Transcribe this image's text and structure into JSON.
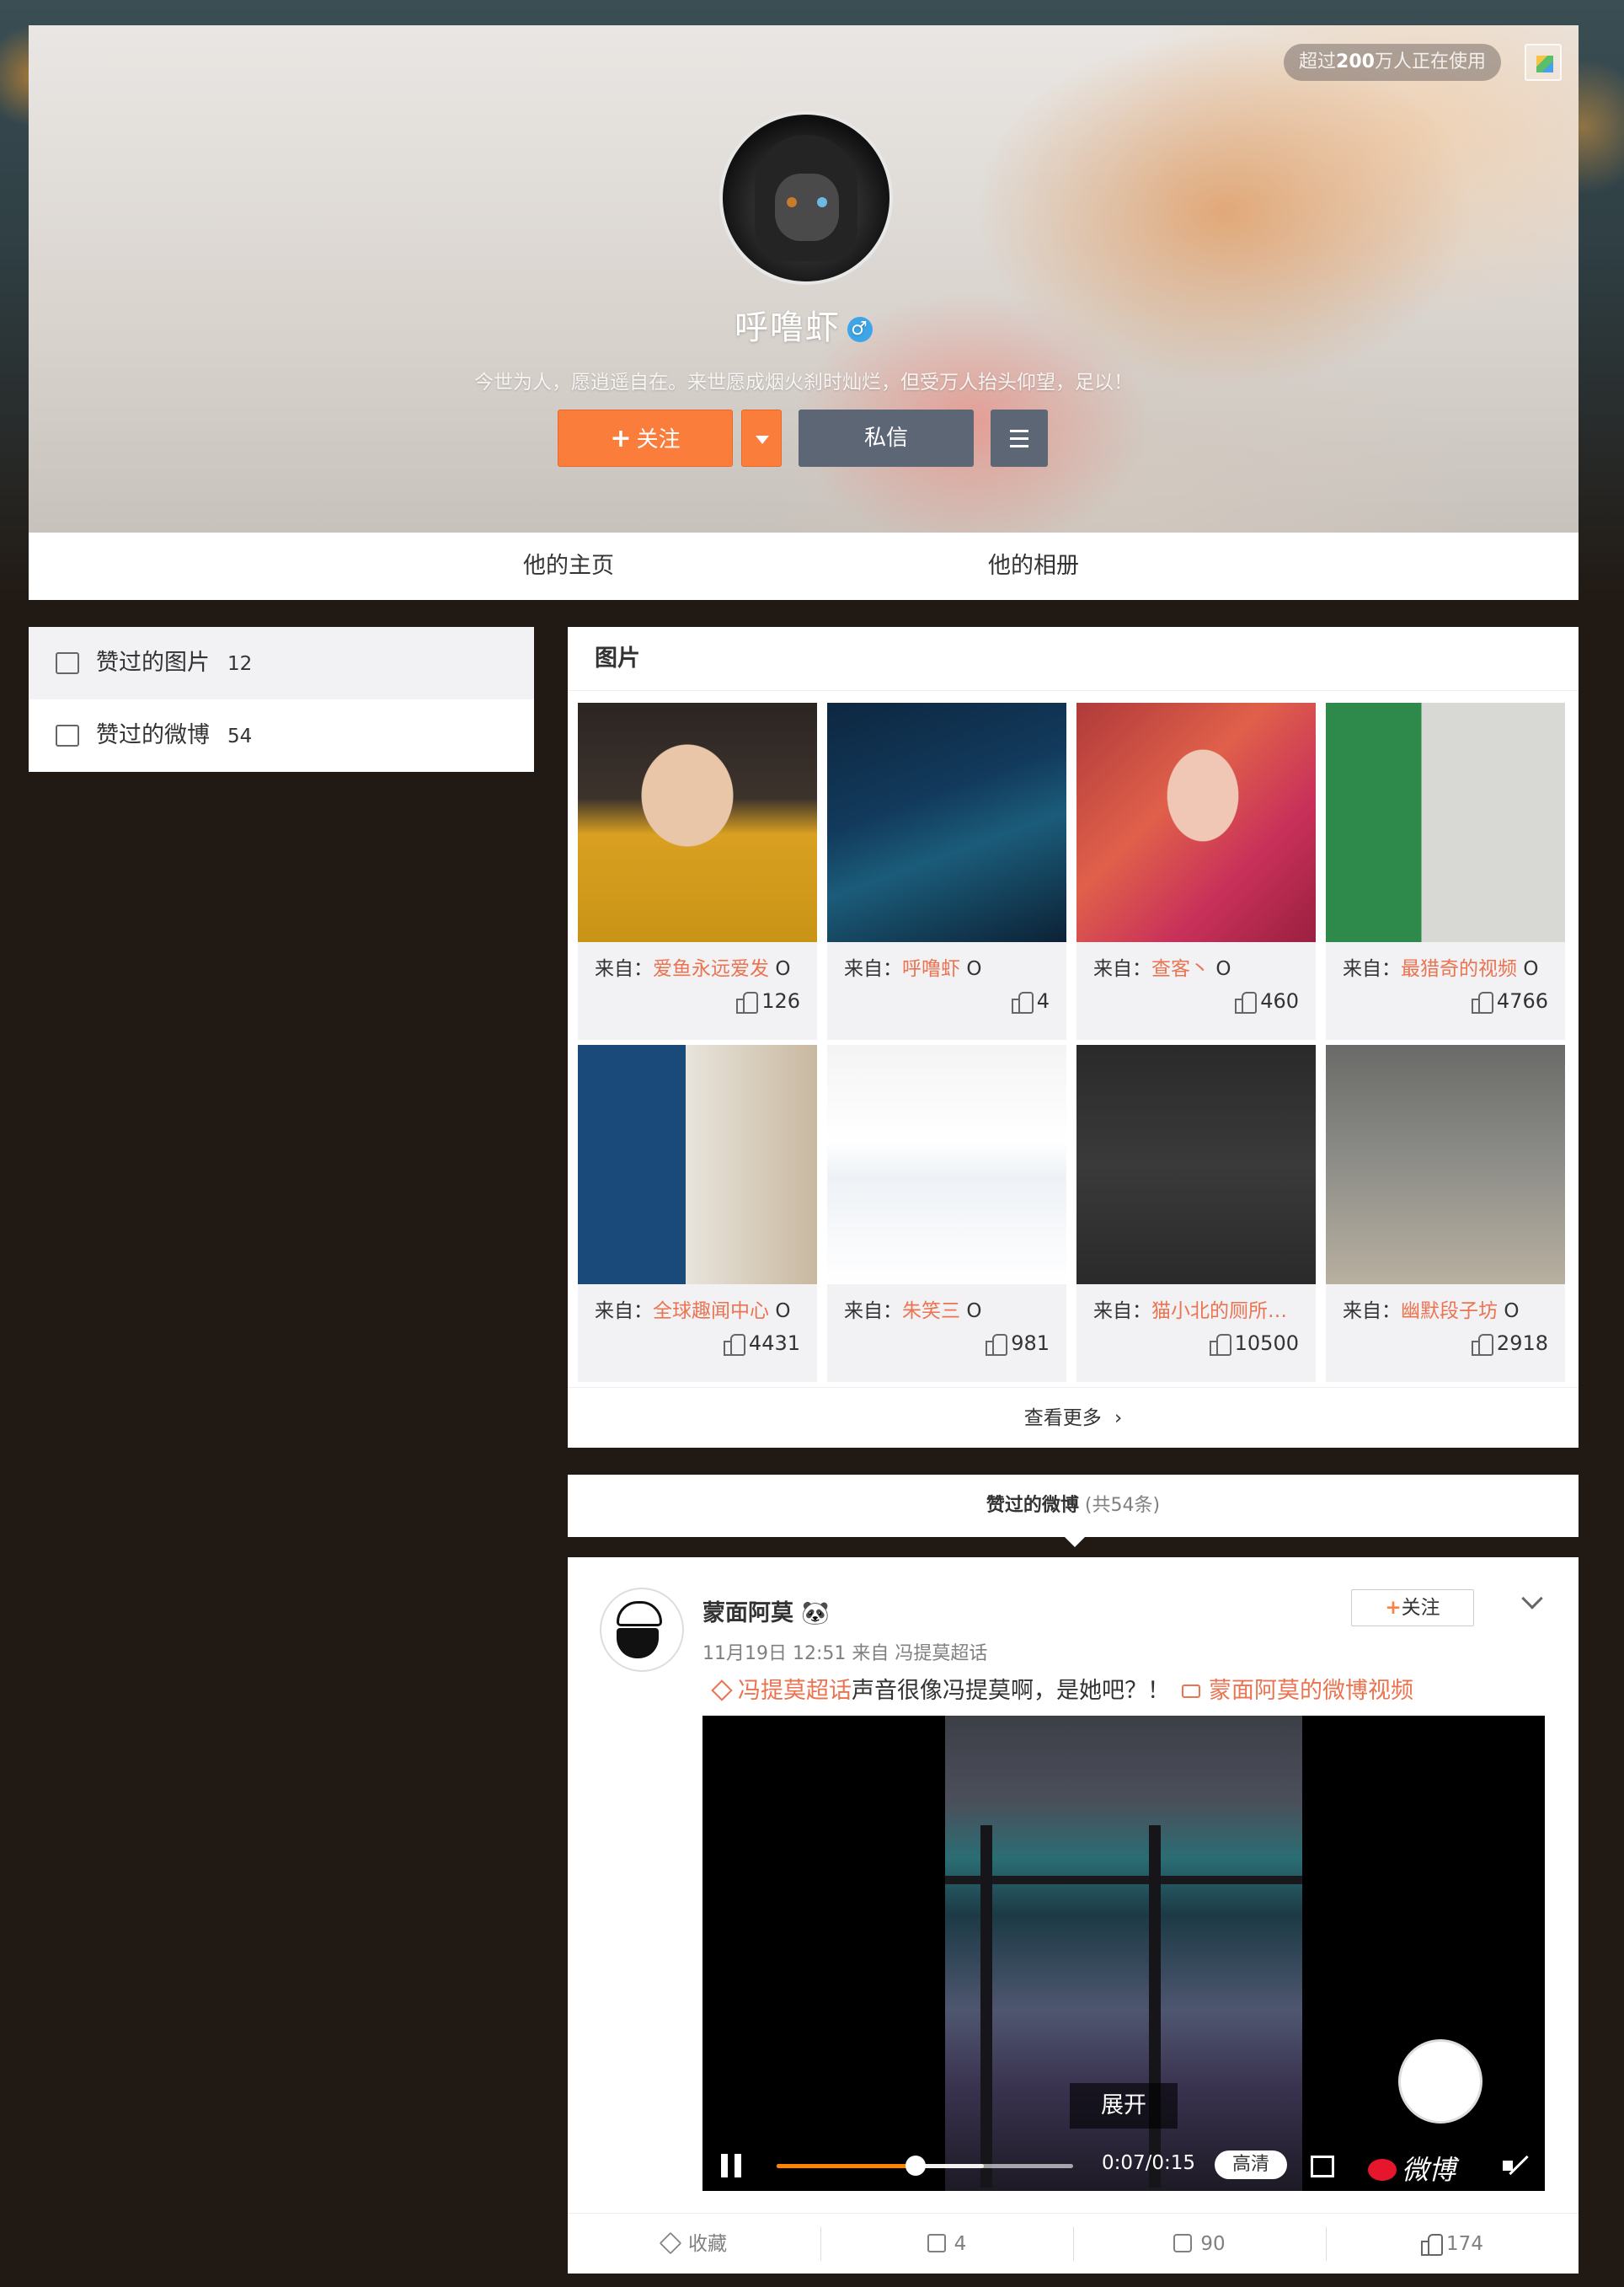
{
  "header": {
    "users_prefix": "超过",
    "users_count": "200",
    "users_suffix": "万人正在使用",
    "username": "呼噜虾",
    "gender_symbol": "♂",
    "bio": "今世为人，愿逍遥自在。来世愿成烟火刹时灿烂，但受万人抬头仰望，足以！",
    "follow_label": "关注",
    "follow_plus": "+",
    "message_label": "私信",
    "tabs": [
      "他的主页",
      "他的相册"
    ]
  },
  "sidebar": {
    "items": [
      {
        "label": "赞过的图片",
        "count": "12"
      },
      {
        "label": "赞过的微博",
        "count": "54"
      }
    ]
  },
  "pictures": {
    "title": "图片",
    "source_prefix": "来自：",
    "tiles": [
      {
        "source": "爱鱼永远爱发",
        "suffix": "O",
        "likes": "126"
      },
      {
        "source": "呼噜虾",
        "suffix": "O",
        "likes": "4"
      },
      {
        "source": "查客丶",
        "suffix": "O",
        "likes": "460"
      },
      {
        "source": "最猎奇的视频",
        "suffix": "O",
        "likes": "4766"
      },
      {
        "source": "全球趣闻中心",
        "suffix": "O",
        "likes": "4431"
      },
      {
        "source": "朱笑三",
        "suffix": "O",
        "likes": "981"
      },
      {
        "source": "猫小北的厕所…",
        "suffix": "",
        "likes": "10500"
      },
      {
        "source": "幽默段子坊",
        "suffix": "O",
        "likes": "2918"
      }
    ],
    "more_label": "查看更多",
    "more_arrow": "›"
  },
  "liked_weibo": {
    "title": "赞过的微博",
    "count_label": "(共54条)"
  },
  "post": {
    "author": "蒙面阿莫",
    "author_emoji": "🐼",
    "meta": "11月19日 12:51 来自 冯提莫超话",
    "follow_plus": "+",
    "follow_label": "关注",
    "topic": "冯提莫超话",
    "text": "声音很像冯提莫啊，是她吧？！",
    "video_link": "蒙面阿莫的微博视频",
    "video": {
      "expand_label": "展开",
      "time": "0:07/0:15",
      "progress": 0.47,
      "buffered": 0.7,
      "quality": "高清",
      "logo": "微博"
    },
    "actions": {
      "favorite": "收藏",
      "share": "4",
      "comment": "90",
      "like": "174"
    }
  },
  "colors": {
    "accent_orange": "#fa7d3c",
    "link_orange": "#eb7350",
    "button_gray": "#5d6675",
    "page_bg": "#211913"
  }
}
